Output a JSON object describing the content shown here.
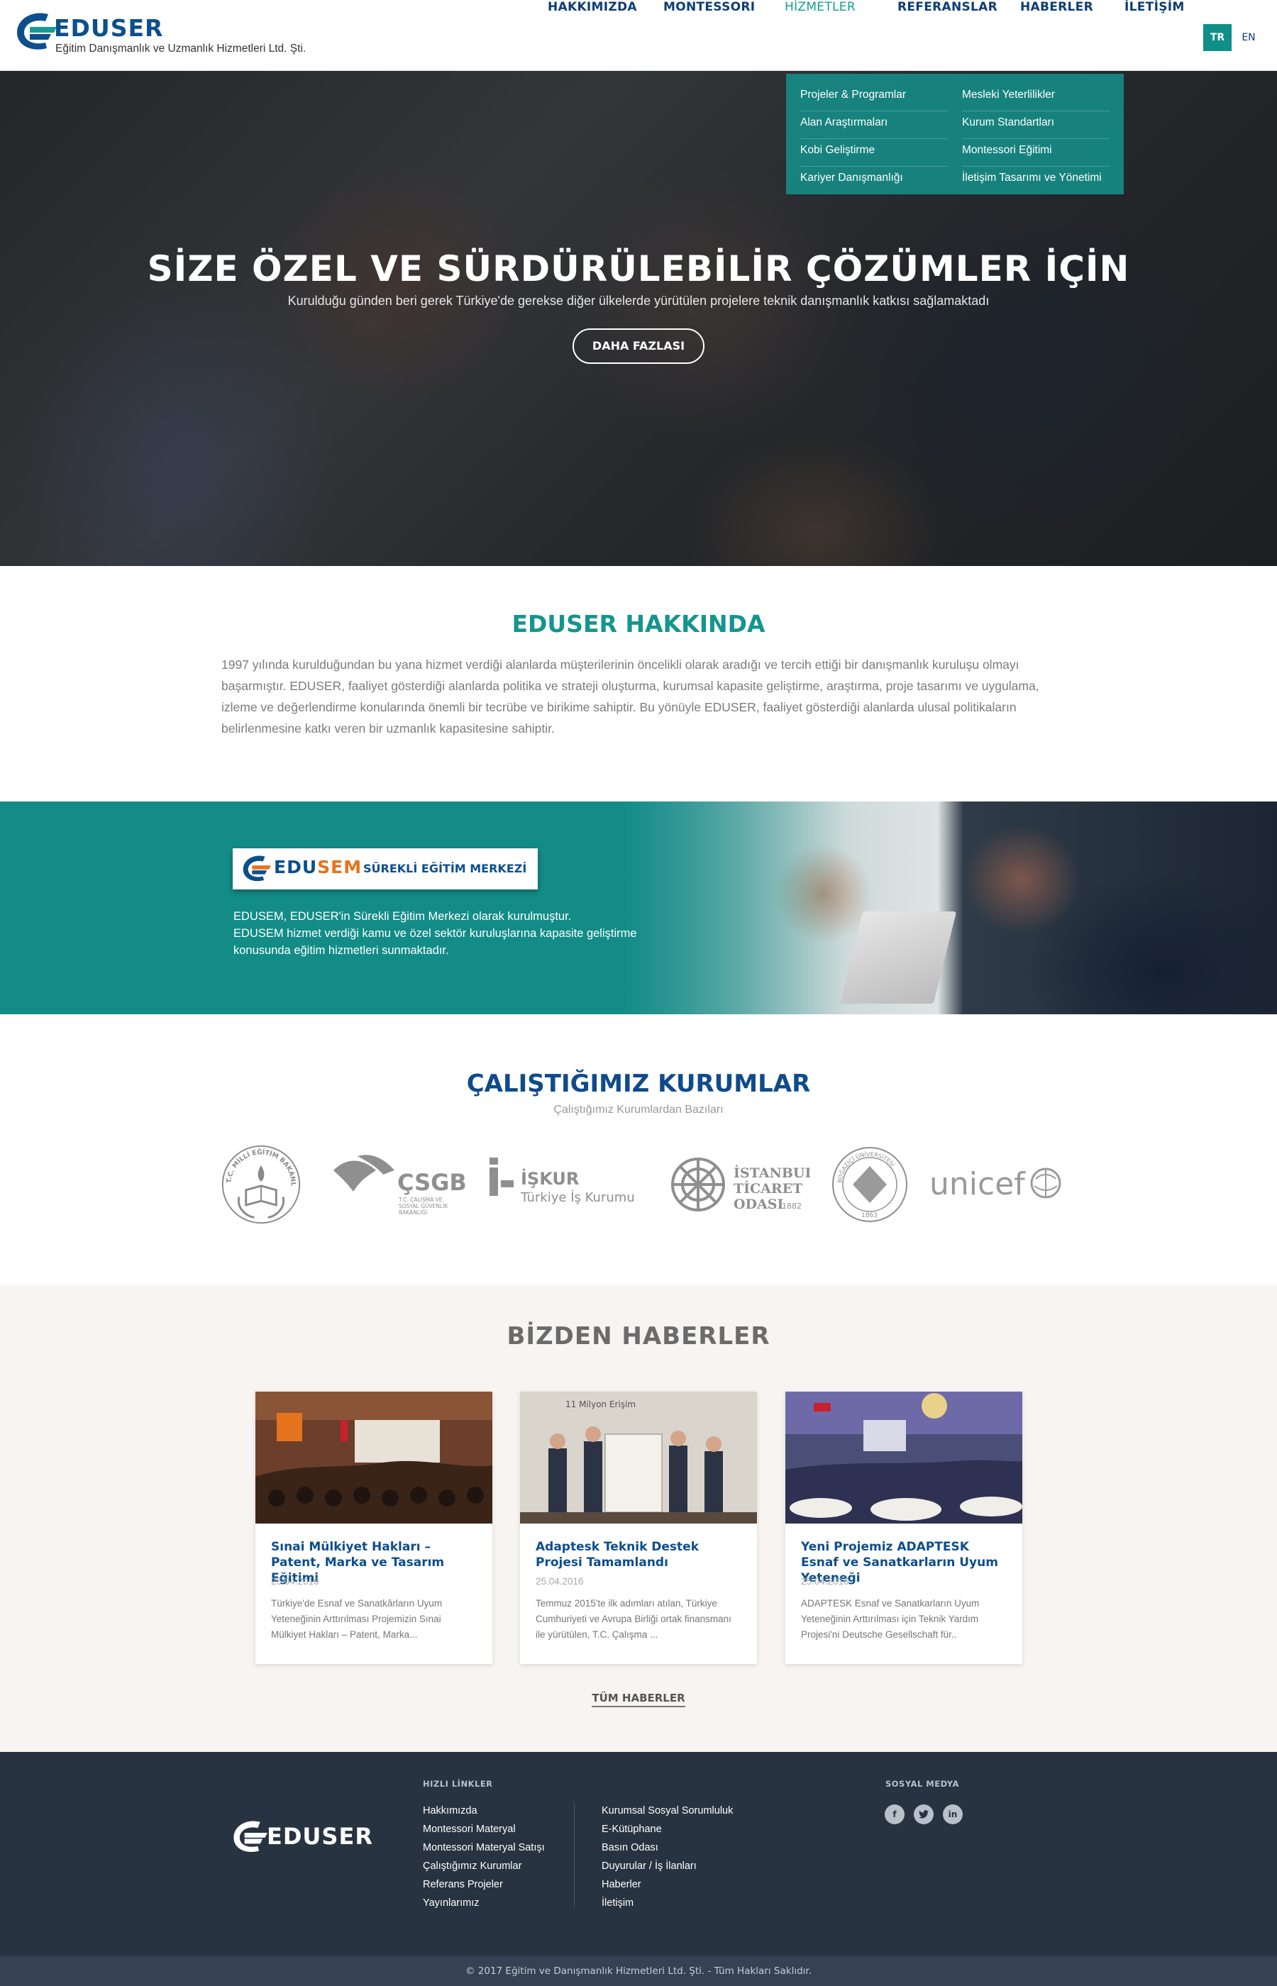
{
  "header": {
    "logo_text": "EDUSER",
    "logo_subtitle": "Eğitim Danışmanlık ve Uzmanlık Hizmetleri Ltd. Şti.",
    "nav": [
      {
        "label": "HAKKIMIZDA",
        "active": false
      },
      {
        "label": "MONTESSORI",
        "active": false
      },
      {
        "label": "HİZMETLER",
        "active": true
      },
      {
        "label": "REFERANSLAR",
        "active": false
      },
      {
        "label": "HABERLER",
        "active": false
      },
      {
        "label": "İLETİŞİM",
        "active": false
      }
    ],
    "lang_tr": "TR",
    "lang_en": "EN"
  },
  "dropdown": {
    "col1": [
      "Projeler & Programlar",
      "Alan Araştırmaları",
      "Kobi Geliştirme",
      "Kariyer Danışmanlığı"
    ],
    "col2": [
      "Mesleki Yeterlilikler",
      "Kurum Standartları",
      "Montessori Eğitimi",
      "İletişim Tasarımı ve Yönetimi"
    ]
  },
  "hero": {
    "title": "SİZE ÖZEL VE SÜRDÜRÜLEBİLİR ÇÖZÜMLER İÇİN",
    "subtitle": "Kurulduğu günden beri gerek Türkiye'de gerekse diğer ülkelerde yürütülen projelere teknik danışmanlık katkısı sağlamaktadı",
    "button": "DAHA FAZLASI"
  },
  "about": {
    "title": "EDUSER HAKKINDA",
    "text": "1997 yılında kurulduğundan bu yana hizmet verdiği alanlarda müşterilerinin öncelikli olarak aradığı ve tercih ettiği bir danışmanlık kuruluşu olmayı başarmıştır. EDUSER,  faaliyet gösterdiği alanlarda politika ve strateji oluşturma, kurumsal kapasite geliştirme, araştırma, proje tasarımı ve uygulama, izleme ve değerlendirme konularında önemli bir tecrübe ve birikime sahiptir. Bu yönüyle EDUSER, faaliyet gösterdiği alanlarda ulusal politikaların belirlenmesine katkı veren bir uzmanlık kapasitesine sahiptir."
  },
  "edusem": {
    "badge_edu": "EDU",
    "badge_sem": "SEM",
    "badge_label": "SÜREKLİ EĞİTİM MERKEZİ",
    "line1": "EDUSEM, EDUSER'in Sürekli Eğitim Merkezi olarak kurulmuştur.",
    "line2": "EDUSEM hizmet verdiği kamu ve özel sektör kuruluşlarına  kapasite geliştirme konusunda eğitim hizmetleri sunmaktadır."
  },
  "partners": {
    "title": "ÇALIŞTIĞIMIZ KURUMLAR",
    "subtitle": "Çalıştığımız Kurumlardan Bazıları",
    "meb_ring": "T.C. MİLLİ EĞİTİM BAKANLIĞI",
    "csgb_name": "ÇSGB",
    "csgb_sub1": "T.C. ÇALIŞMA VE",
    "csgb_sub2": "SOSYAL GÜVENLİK",
    "csgb_sub3": "BAKANLIĞI",
    "iskur_name": "İŞKUR",
    "iskur_sub": "Türkiye İş Kurumu",
    "ito_line1": "İSTANBUL",
    "ito_line2": "TİCARET",
    "ito_line3": "ODASI",
    "ito_year": "1882",
    "boun_ring": "BOĞAZİÇİ ÜNİVERSİTESİ",
    "boun_year": "1863",
    "unicef_name": "unicef"
  },
  "news": {
    "title": "BİZDEN HABERLER",
    "photo_caption": "11 Milyon Erişim",
    "cards": [
      {
        "title": "Sınai Mülkiyet Hakları – Patent, Marka ve Tasarım Eğitimi",
        "date": "25.04.2016",
        "text": "Türkiye'de Esnaf ve Sanatkârların Uyum Yeteneğinin Arttırılması Projemizin Sınai Mülkiyet Hakları – Patent, Marka..."
      },
      {
        "title": "Adaptesk Teknik Destek Projesi Tamamlandı",
        "date": "25.04.2016",
        "text": "Temmuz 2015'te ilk adımları atılan, Türkiye Cumhuriyeti ve Avrupa Birliği ortak finansmanı ile yürütülen, T.C. Çalışma ..."
      },
      {
        "title": "Yeni Projemiz ADAPTESK Esnaf ve Sanatkarların Uyum Yeteneği",
        "date": "25.04.2016",
        "text": "ADAPTESK Esnaf ve Sanatkarların Uyum Yeteneğinin Arttırılması için Teknik Yardım Projesi'ni Deutsche Gesellschaft für.."
      }
    ],
    "all_news": "TÜM HABERLER"
  },
  "footer": {
    "logo_text": "EDUSER",
    "quick_links_title": "HIZLI LİNKLER",
    "links_col1": [
      "Hakkımızda",
      "Montessori Materyal",
      "Montessori Materyal Satışı",
      "Çalıştığımız Kurumlar",
      "Referans Projeler",
      "Yayınlarımız"
    ],
    "links_col2": [
      "Kurumsal Sosyal Sorumluluk",
      "E-Kütüphane",
      "Basın Odası",
      "Duyurular / İş İlanları",
      "Haberler",
      "İletişim"
    ],
    "social_title": "SOSYAL MEDYA",
    "facebook": "f",
    "linkedin": "in",
    "copyright": "© 2017 Eğitim ve Danışmanlık Hizmetleri Ltd. Şti.  -  Tüm Hakları Saklıdır."
  },
  "colors": {
    "brand_blue": "#0c4f8c",
    "brand_teal": "#14958e",
    "accent_orange": "#e4741d",
    "footer_bg": "#283341"
  },
  "icons": [
    "eduser-logo-mark",
    "facebook-icon",
    "twitter-icon",
    "linkedin-icon"
  ]
}
